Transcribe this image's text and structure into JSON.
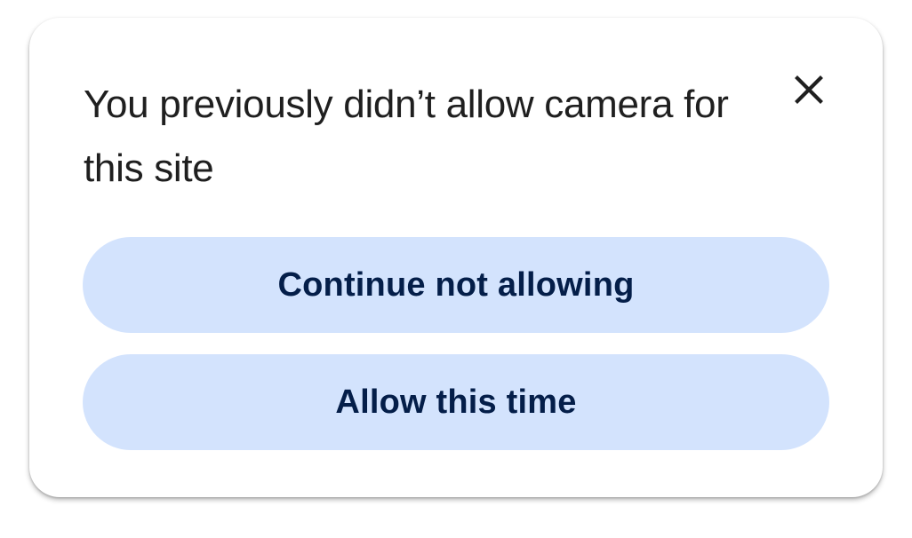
{
  "dialog": {
    "title": "You previously didn’t allow camera for this site",
    "close_icon": "close-icon",
    "buttons": {
      "continue_not_allowing": "Continue not allowing",
      "allow_this_time": "Allow this time"
    }
  },
  "colors": {
    "button_bg": "#d3e3fd",
    "button_text": "#041e49",
    "title_text": "#1f1f1f",
    "dialog_bg": "#ffffff"
  }
}
